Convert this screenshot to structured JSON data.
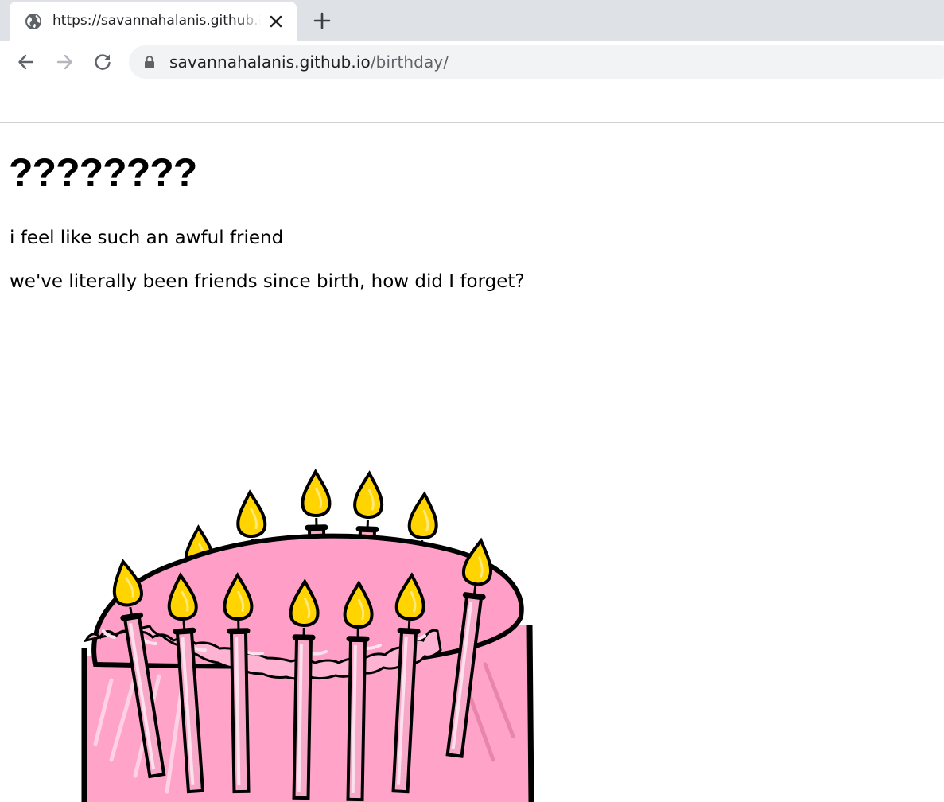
{
  "browser": {
    "tab": {
      "title": "https://savannahalanis.github.io/birthday/",
      "favicon_icon": "globe-icon",
      "close_icon": "close-icon"
    },
    "new_tab_icon": "plus-icon",
    "nav": {
      "back_icon": "arrow-left-icon",
      "forward_icon": "arrow-right-icon",
      "reload_icon": "reload-icon"
    },
    "address": {
      "lock_icon": "lock-icon",
      "host": "savannahalanis.github.io",
      "path": "/birthday/"
    }
  },
  "page": {
    "heading": "????????",
    "paragraphs": [
      "i feel like such an awful friend",
      "we've literally been friends since birth, how did I forget?"
    ],
    "image": {
      "icon": "birthday-cake-icon",
      "colors": {
        "frosting": "#ffa3c8",
        "candle": "#f7a8c8",
        "flame": "#ffd400",
        "outline": "#000000"
      }
    }
  }
}
